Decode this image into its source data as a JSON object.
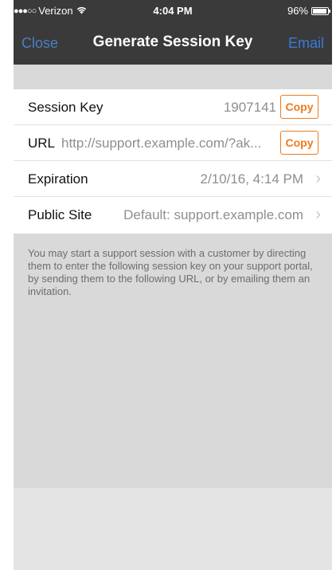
{
  "status_bar": {
    "signal": "●●●○○",
    "carrier": "Verizon",
    "wifi": "wifi-icon",
    "time": "4:04 PM",
    "battery": "96%"
  },
  "nav": {
    "close_label": "Close",
    "title": "Generate Session Key",
    "email_label": "Email"
  },
  "rows": {
    "session_key": {
      "label": "Session Key",
      "value": "1907141",
      "copy_label": "Copy"
    },
    "url": {
      "label": "URL",
      "value": "http://support.example.com/?ak...",
      "copy_label": "Copy"
    },
    "expiration": {
      "label": "Expiration",
      "value": "2/10/16, 4:14 PM"
    },
    "public_site": {
      "label": "Public Site",
      "value": "Default: support.example.com"
    }
  },
  "footer_text": "You may start a support session with a customer by directing them to enter the following session key on your support portal, by sending them to the following URL, or by emailing them an invitation.",
  "colors": {
    "nav_background": "#3a3a3a",
    "accent_blue": "#3b7ad8",
    "copy_orange": "#f07a1a",
    "background_gray": "#d9d9d9"
  }
}
